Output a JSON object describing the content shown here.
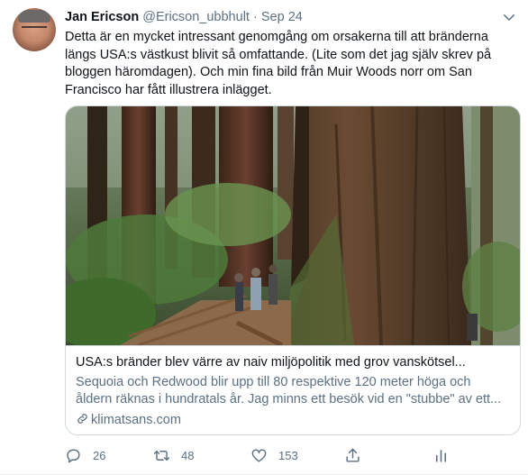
{
  "author": {
    "name": "Jan Ericson",
    "handle": "@Ericson_ubbhult",
    "separator": "·",
    "date": "Sep 24"
  },
  "tweet": {
    "text_lines": [
      "Detta är en mycket intressant genomgång om orsakerna till att bränderna",
      "längs USA:s västkust blivit så omfattande. (Lite som det jag själv skrev på",
      "bloggen häromdagen). Och min fina bild från Muir Woods norr om San",
      "Francisco har fått illustrera inlägget."
    ]
  },
  "card": {
    "title": "USA:s bränder blev värre av naiv miljöpolitik med grov vanskötsel...",
    "description_lines": [
      "Sequoia och Redwood blir upp till 80 respektive 120 meter höga och",
      "åldern räknas i hundratals år. Jag minns ett besök vid en \"stubbe\" av ett..."
    ],
    "domain": "klimatsans.com"
  },
  "actions": {
    "reply_count": "26",
    "retweet_count": "48",
    "like_count": "153"
  },
  "colors": {
    "text": "#0f1419",
    "secondary": "#5b7083",
    "border": "#cfd9de"
  },
  "icons": [
    "caret-down-icon",
    "link-icon",
    "reply-icon",
    "retweet-icon",
    "like-icon",
    "analytics-icon"
  ]
}
